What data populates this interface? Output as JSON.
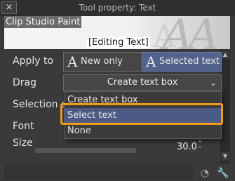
{
  "window": {
    "title": "Tool property: Text",
    "close_label": "×"
  },
  "preview": {
    "brand": "Clip Studio Paint",
    "caption": "[Editing Text]",
    "glyph_large": "AA",
    "glyph_small": "A"
  },
  "apply_to": {
    "label": "Apply to",
    "options": [
      {
        "label": "New only",
        "icon": "text-a-icon",
        "selected": false
      },
      {
        "label": "Selected text",
        "icon": "text-select-icon",
        "selected": true
      }
    ]
  },
  "drag": {
    "label": "Drag",
    "value": "Create text box",
    "dropdown_options": [
      "Create text box",
      "Select text",
      "None"
    ],
    "hovered_option": "Select text"
  },
  "selection": {
    "label": "Selection a"
  },
  "font": {
    "label": "Font"
  },
  "size": {
    "label": "Size",
    "value": "30.0"
  },
  "colors": {
    "accent": "#f09a1b",
    "selected": "#53628c",
    "hover": "#4b5b86",
    "background": "#3a3a3a"
  },
  "footer": {
    "icons": [
      "rotation-dial-icon",
      "wrench-icon"
    ]
  }
}
